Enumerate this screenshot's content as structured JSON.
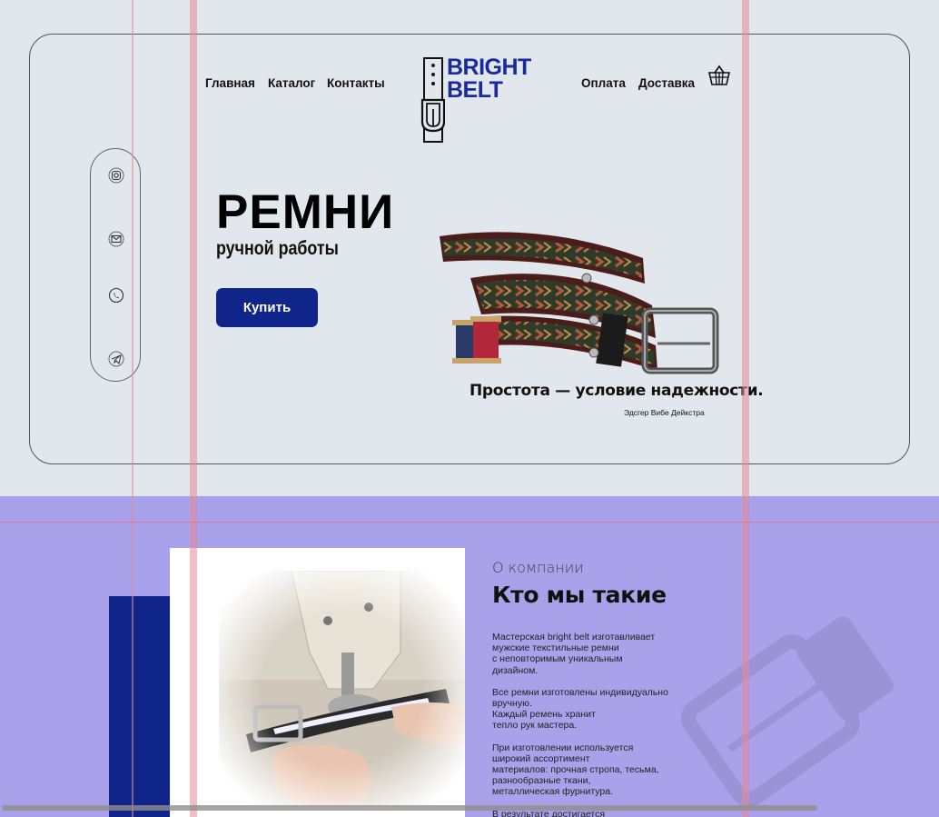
{
  "nav": {
    "left": [
      "Главная",
      "Каталог",
      "Контакты"
    ],
    "right": [
      "Оплата",
      "Доставка"
    ],
    "cart_icon": "basket-icon"
  },
  "logo": {
    "line1": "BRIGHT",
    "line2": "BELT",
    "icon": "belt-buckle-logo-icon",
    "color": "#1a2a9a"
  },
  "social": {
    "icons": [
      "instagram-icon",
      "mail-icon",
      "whatsapp-icon",
      "telegram-icon"
    ]
  },
  "hero": {
    "title": "РЕМНИ",
    "subtitle": "ручной работы",
    "buy_label": "Купить",
    "quote": "Простота — условие надежности.",
    "quote_author": "Эдсгер Вибе Дейкстра"
  },
  "about": {
    "eyebrow": "О компании",
    "title": "Кто мы такие",
    "paragraphs": [
      "Мастерская bright belt  изготавливает\nмужские текстильные ремни\nс неповторимым уникальным\nдизайном.",
      "Все ремни изготовлены индивидуально\n вручную.\nКаждый ремень хранит\nтепло рук мастера.",
      "При изготовлении используется\nширокий ассортимент\n материалов: прочная стропа, тесьма,\n разнообразные ткани,\nметаллическая фурнитура.",
      "В результате достигается"
    ]
  },
  "colors": {
    "accent": "#10258a",
    "hero_bg": "#e1e7ec",
    "about_bg": "#a9a1ea"
  }
}
